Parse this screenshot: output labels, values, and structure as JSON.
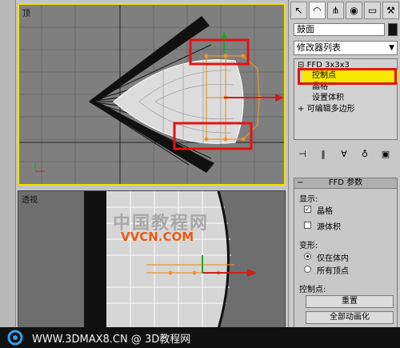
{
  "viewports": {
    "top": {
      "label": "顶"
    },
    "perspective": {
      "label": "透视"
    }
  },
  "command_panel": {
    "object_name": "鼓面",
    "modifier_list": "修改器列表",
    "stack": [
      {
        "label": "FFD 3x3x3",
        "symbol": "⊟"
      },
      {
        "label": "控制点"
      },
      {
        "label": "晶格"
      },
      {
        "label": "设置体积"
      },
      {
        "label": "可编辑多边形",
        "symbol": "+"
      }
    ],
    "ffd_rollout": {
      "title": "FFD 参数",
      "display_group": "显示:",
      "lattice_label": "晶格",
      "lattice_checked": true,
      "source_volume_label": "源体积",
      "source_volume_checked": false,
      "deform_group": "变形:",
      "only_in_volume_label": "仅在体内",
      "all_vertices_label": "所有顶点",
      "control_points_group": "控制点:",
      "reset_label": "重置",
      "animate_all_label": "全部动画化"
    }
  },
  "watermark": {
    "overlay": "中国教程网",
    "domain": "VVCN.COM",
    "footer": "WWW.3DMAX8.CN @ 3D教程网"
  },
  "colors": {
    "viewport_active": "#f0e000",
    "highlight": "#f6e800",
    "annotation": "#e41212",
    "gizmo": "#e8962a"
  }
}
